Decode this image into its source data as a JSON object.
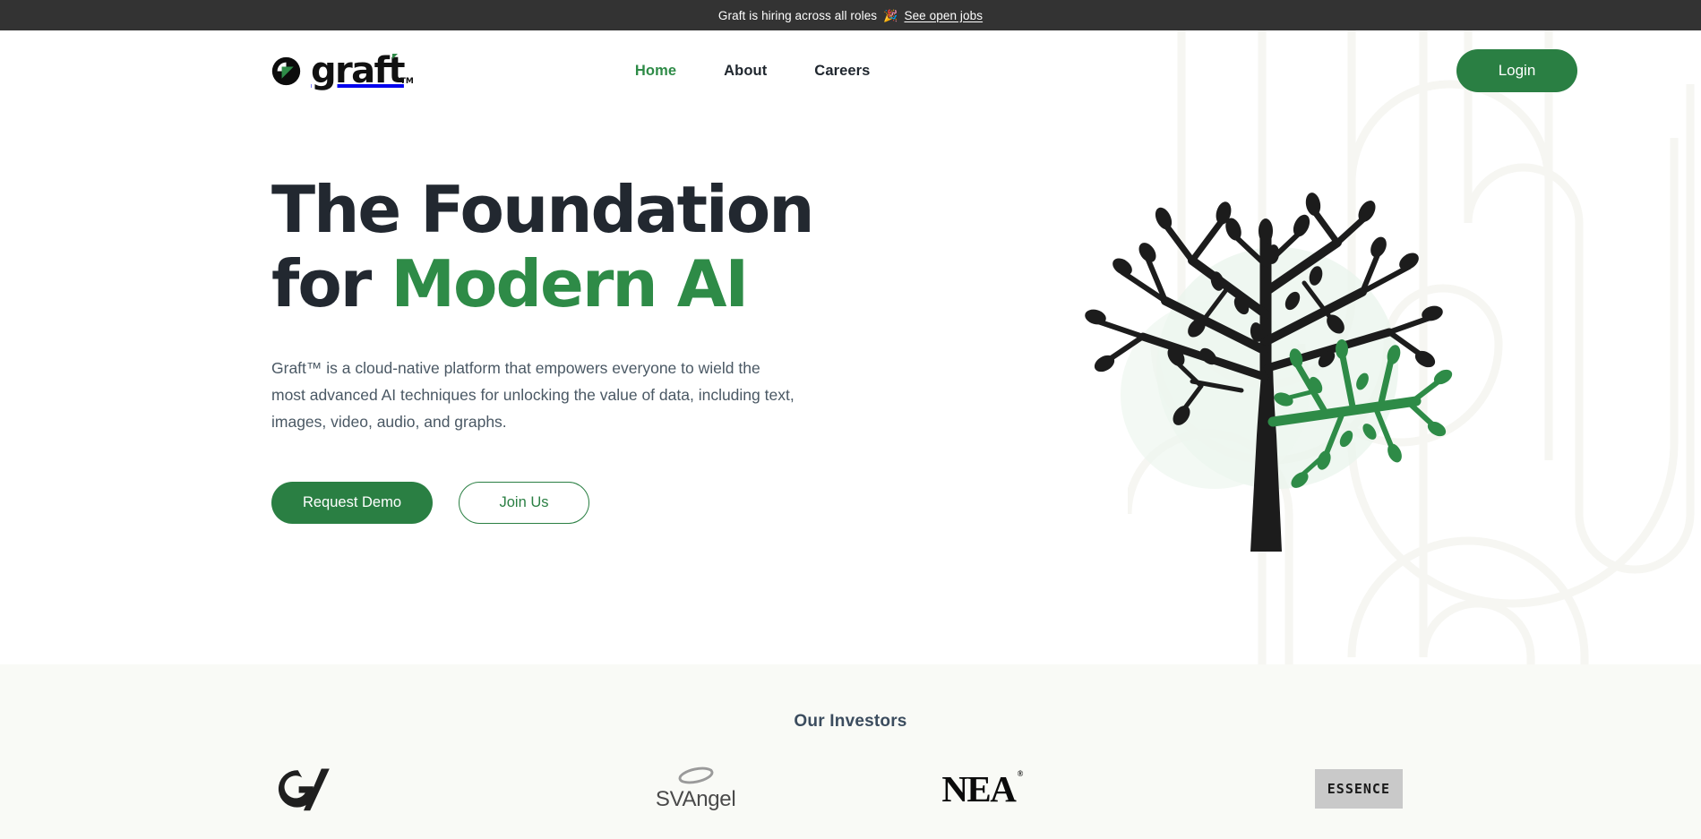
{
  "announcement": {
    "text": "Graft is hiring across all roles",
    "emoji": "🎉",
    "link_label": "See open jobs"
  },
  "header": {
    "logo_word": "graft",
    "logo_tm": "TM",
    "logo_mark_icon": "graft-circle-triangle-logo",
    "nav": [
      {
        "label": "Home",
        "active": true
      },
      {
        "label": "About",
        "active": false
      },
      {
        "label": "Careers",
        "active": false
      }
    ],
    "login_label": "Login"
  },
  "hero": {
    "title_line1": "The Foundation",
    "title_line2_plain": "for ",
    "title_line2_accent": "Modern AI",
    "subtitle": "Graft™ is a cloud-native platform that empowers everyone to wield the most advanced AI techniques for unlocking the value of data, including text, images, video, audio, and graphs.",
    "primary_cta": "Request Demo",
    "secondary_cta": "Join Us",
    "illustration_icon": "grafted-tree-illustration"
  },
  "investors": {
    "title": "Our Investors",
    "logos": [
      {
        "name": "GV",
        "icon": "gv-logo"
      },
      {
        "name": "SVAngel",
        "icon": "svangel-logo"
      },
      {
        "name": "NEA",
        "icon": "nea-logo",
        "mark": "®"
      },
      {
        "name": "ESSENCE",
        "icon": "essence-logo"
      }
    ]
  },
  "colors": {
    "brand_green": "#2e8b47",
    "button_green": "#2a7f43",
    "headline_dark": "#222830",
    "body_text": "#4a5864",
    "banner_bg": "#333333",
    "investors_bg": "#f9faf6",
    "pattern_stroke": "#f6f6f2"
  }
}
